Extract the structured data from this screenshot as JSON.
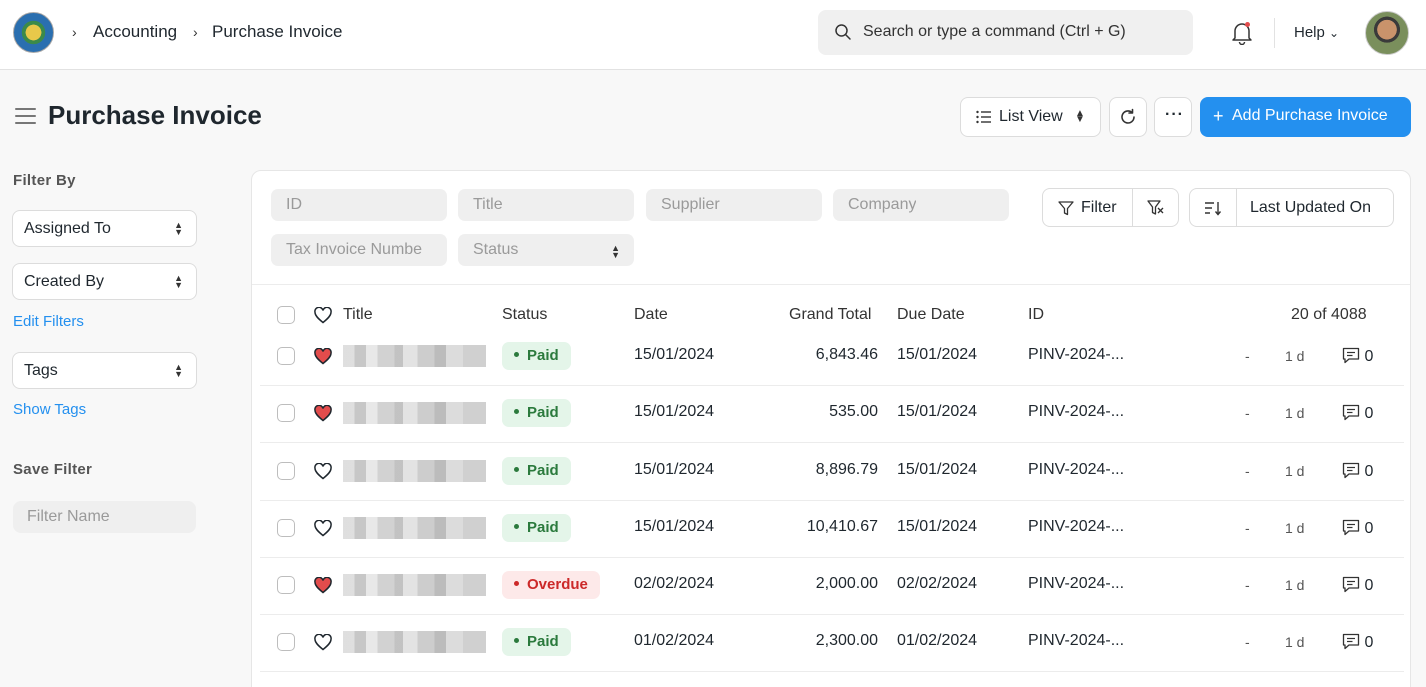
{
  "navbar": {
    "breadcrumbs": [
      "Accounting",
      "Purchase Invoice"
    ],
    "search_placeholder": "Search or type a command (Ctrl + G)",
    "help_label": "Help"
  },
  "header": {
    "title": "Purchase Invoice",
    "list_view_label": "List View",
    "more_label": "···",
    "add_label": "Add Purchase Invoice",
    "accent_color": "#2490ef"
  },
  "sidebar": {
    "filter_by_heading": "Filter By",
    "assigned_to": "Assigned To",
    "created_by": "Created By",
    "edit_filters": "Edit Filters",
    "tags": "Tags",
    "show_tags": "Show Tags",
    "save_filter_heading": "Save Filter",
    "filter_name_placeholder": "Filter Name"
  },
  "filters": {
    "id": "ID",
    "title": "Title",
    "supplier": "Supplier",
    "company": "Company",
    "tax_invoice": "Tax Invoice Numbe",
    "status": "Status",
    "filter_label": "Filter",
    "sort_label": "Last Updated On"
  },
  "table": {
    "columns": {
      "title": "Title",
      "status": "Status",
      "date": "Date",
      "grand_total": "Grand Total",
      "due_date": "Due Date",
      "id": "ID",
      "count": "20 of 4088"
    },
    "rows": [
      {
        "liked": true,
        "status": "Paid",
        "date": "15/01/2024",
        "grand_total": "6,843.46",
        "due_date": "15/01/2024",
        "id": "PINV-2024-...",
        "assigned": "-",
        "modified": "1 d",
        "comments": "0"
      },
      {
        "liked": true,
        "status": "Paid",
        "date": "15/01/2024",
        "grand_total": "535.00",
        "due_date": "15/01/2024",
        "id": "PINV-2024-...",
        "assigned": "-",
        "modified": "1 d",
        "comments": "0"
      },
      {
        "liked": false,
        "status": "Paid",
        "date": "15/01/2024",
        "grand_total": "8,896.79",
        "due_date": "15/01/2024",
        "id": "PINV-2024-...",
        "assigned": "-",
        "modified": "1 d",
        "comments": "0"
      },
      {
        "liked": false,
        "status": "Paid",
        "date": "15/01/2024",
        "grand_total": "10,410.67",
        "due_date": "15/01/2024",
        "id": "PINV-2024-...",
        "assigned": "-",
        "modified": "1 d",
        "comments": "0"
      },
      {
        "liked": true,
        "status": "Overdue",
        "date": "02/02/2024",
        "grand_total": "2,000.00",
        "due_date": "02/02/2024",
        "id": "PINV-2024-...",
        "assigned": "-",
        "modified": "1 d",
        "comments": "0"
      },
      {
        "liked": false,
        "status": "Paid",
        "date": "01/02/2024",
        "grand_total": "2,300.00",
        "due_date": "01/02/2024",
        "id": "PINV-2024-...",
        "assigned": "-",
        "modified": "1 d",
        "comments": "0"
      }
    ]
  }
}
